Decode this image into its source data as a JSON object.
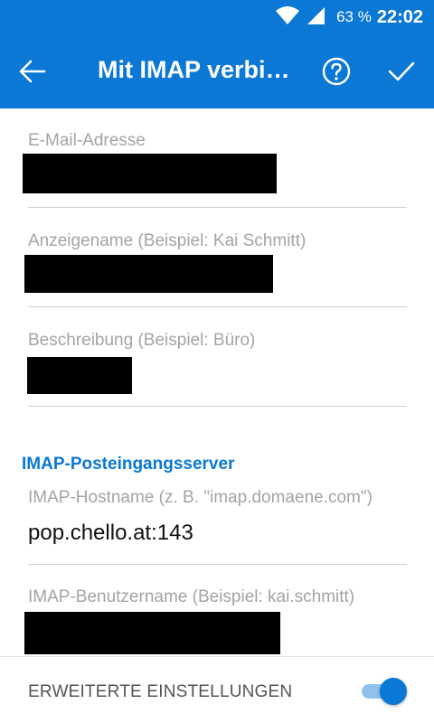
{
  "status_bar": {
    "battery": "63 %",
    "time": "22:02",
    "wifi_icon": "wifi-icon",
    "signal_icon": "cell-signal-icon"
  },
  "toolbar": {
    "title": "Mit IMAP verbinden",
    "back_icon": "arrow-left-icon",
    "help_icon": "help-circle-icon",
    "confirm_icon": "checkmark-icon"
  },
  "form": {
    "email": {
      "label": "E-Mail-Adresse",
      "redacted": true
    },
    "display_name": {
      "label": "Anzeigename (Beispiel: Kai Schmitt)",
      "redacted": true
    },
    "description": {
      "label": "Beschreibung (Beispiel: Büro)",
      "redacted": true
    },
    "imap_section": {
      "heading": "IMAP-Posteingangsserver"
    },
    "imap_host": {
      "label": "IMAP-Hostname (z. B. \"imap.domaene.com\")",
      "value": "pop.chello.at:143"
    },
    "imap_user": {
      "label": "IMAP-Benutzername (Beispiel: kai.schmitt)",
      "redacted": true
    }
  },
  "advanced": {
    "label": "ERWEITERTE EINSTELLUNGEN",
    "enabled": true
  },
  "colors": {
    "accent": "#0a78d4",
    "toggle_track": "#8fc1ea",
    "label_gray": "#a4a4a4"
  }
}
